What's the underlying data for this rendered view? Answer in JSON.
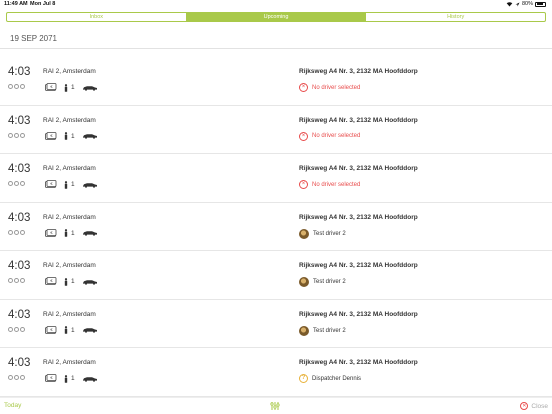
{
  "status_bar": {
    "time": "11:49 AM",
    "date": "Mon Jul 8",
    "battery": "80%",
    "battery_level": 0.8
  },
  "tabs": [
    {
      "label": "Inbox",
      "active": false
    },
    {
      "label": "Upcoming",
      "active": true
    },
    {
      "label": "History",
      "active": false
    }
  ],
  "date_header": "19 SEP 2071",
  "rides": [
    {
      "time": "4:03",
      "origin": "RAI 2, Amsterdam",
      "passengers": "1",
      "destination": "Rijksweg A4 Nr. 3, 2132 MA Hoofddorp",
      "driver_status": "none",
      "driver": "No driver selected"
    },
    {
      "time": "4:03",
      "origin": "RAI 2, Amsterdam",
      "passengers": "1",
      "destination": "Rijksweg A4 Nr. 3, 2132 MA Hoofddorp",
      "driver_status": "none",
      "driver": "No driver selected"
    },
    {
      "time": "4:03",
      "origin": "RAI 2, Amsterdam",
      "passengers": "1",
      "destination": "Rijksweg A4 Nr. 3, 2132 MA Hoofddorp",
      "driver_status": "none",
      "driver": "No driver selected"
    },
    {
      "time": "4:03",
      "origin": "RAI 2, Amsterdam",
      "passengers": "1",
      "destination": "Rijksweg A4 Nr. 3, 2132 MA Hoofddorp",
      "driver_status": "assigned",
      "driver": "Test driver 2"
    },
    {
      "time": "4:03",
      "origin": "RAI 2, Amsterdam",
      "passengers": "1",
      "destination": "Rijksweg A4 Nr. 3, 2132 MA Hoofddorp",
      "driver_status": "assigned",
      "driver": "Test driver 2"
    },
    {
      "time": "4:03",
      "origin": "RAI 2, Amsterdam",
      "passengers": "1",
      "destination": "Rijksweg A4 Nr. 3, 2132 MA Hoofddorp",
      "driver_status": "assigned",
      "driver": "Test driver 2"
    },
    {
      "time": "4:03",
      "origin": "RAI 2, Amsterdam",
      "passengers": "1",
      "destination": "Rijksweg A4 Nr. 3, 2132 MA Hoofddorp",
      "driver_status": "dispatcher",
      "driver": "Dispatcher Dennis"
    }
  ],
  "bottom_bar": {
    "today_label": "Today",
    "close_label": "Close"
  },
  "colors": {
    "accent": "#a9c94a",
    "error": "#e84c4c",
    "warning": "#e8b23a"
  }
}
